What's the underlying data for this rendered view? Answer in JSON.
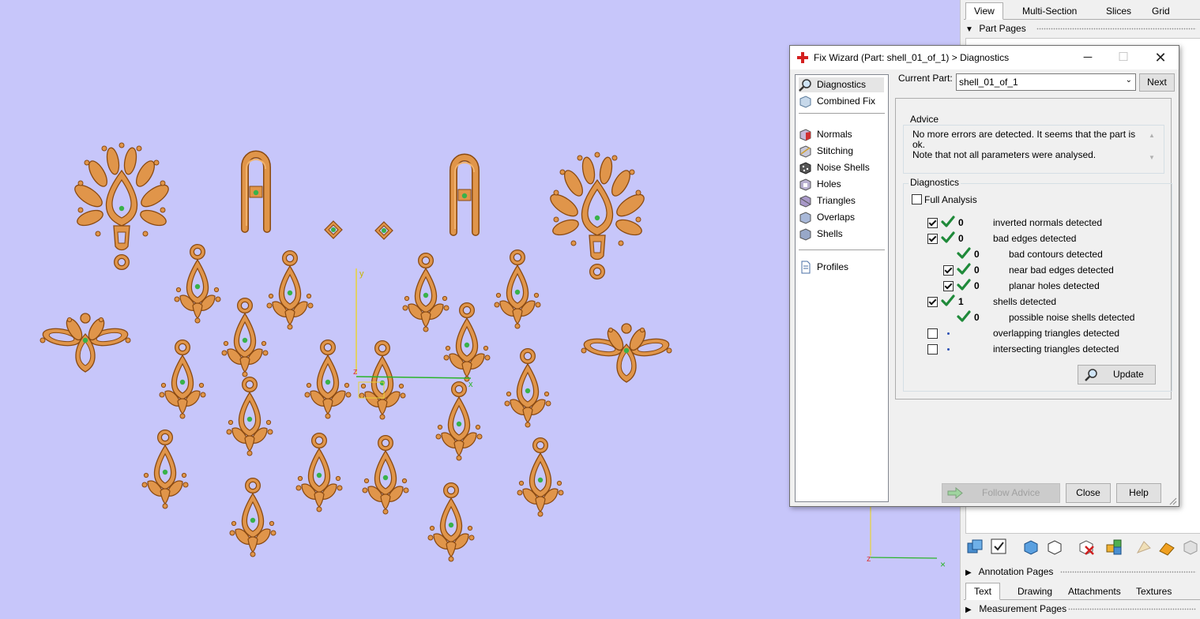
{
  "right_panel": {
    "top_tabs": [
      "View",
      "Multi-Section",
      "Slices",
      "Grid"
    ],
    "part_pages_label": "Part Pages",
    "annotation_pages_label": "Annotation Pages",
    "bottom_tabs": [
      "Text",
      "Drawing",
      "Attachments",
      "Textures"
    ],
    "measurement_pages_label": "Measurement Pages"
  },
  "dialog": {
    "title": "Fix Wizard (Part: shell_01_of_1) > Diagnostics",
    "nav_items": [
      {
        "label": "Diagnostics",
        "icon": "magnifier-icon"
      },
      {
        "label": "Combined Fix",
        "icon": "cube-icon"
      },
      {
        "label": "Normals",
        "icon": "normals-cube-icon"
      },
      {
        "label": "Stitching",
        "icon": "stitching-cube-icon"
      },
      {
        "label": "Noise Shells",
        "icon": "noise-shells-icon"
      },
      {
        "label": "Holes",
        "icon": "holes-cube-icon"
      },
      {
        "label": "Triangles",
        "icon": "triangles-cube-icon"
      },
      {
        "label": "Overlaps",
        "icon": "overlaps-cube-icon"
      },
      {
        "label": "Shells",
        "icon": "shells-cube-icon"
      },
      {
        "label": "Profiles",
        "icon": "profiles-document-icon"
      }
    ],
    "current_part_label": "Current Part:",
    "current_part_value": "shell_01_of_1",
    "next_label": "Next",
    "advice_label": "Advice",
    "advice_text": "No more errors are detected. It seems that the part is ok.\nNote that not all parameters were analysed.",
    "diagnostics_label": "Diagnostics",
    "full_analysis_label": "Full Analysis",
    "rows": [
      {
        "checkbox": true,
        "checked": true,
        "status": "ok",
        "count": "0",
        "label": "inverted normals detected",
        "indent": 0
      },
      {
        "checkbox": true,
        "checked": true,
        "status": "ok",
        "count": "0",
        "label": "bad edges detected",
        "indent": 0
      },
      {
        "checkbox": false,
        "checked": false,
        "status": "ok",
        "count": "0",
        "label": "bad contours detected",
        "indent": 1
      },
      {
        "checkbox": true,
        "checked": true,
        "status": "ok",
        "count": "0",
        "label": "near bad edges detected",
        "indent": 1
      },
      {
        "checkbox": true,
        "checked": true,
        "status": "ok",
        "count": "0",
        "label": "planar holes detected",
        "indent": 1
      },
      {
        "checkbox": true,
        "checked": true,
        "status": "ok",
        "count": "1",
        "label": "shells detected",
        "indent": 0
      },
      {
        "checkbox": false,
        "checked": false,
        "status": "ok",
        "count": "0",
        "label": "possible noise shells detected",
        "indent": 1
      },
      {
        "checkbox": true,
        "checked": false,
        "status": "none",
        "count": "",
        "label": "overlapping triangles detected",
        "indent": 0
      },
      {
        "checkbox": true,
        "checked": false,
        "status": "none",
        "count": "",
        "label": "intersecting triangles detected",
        "indent": 0
      }
    ],
    "update_label": "Update",
    "follow_advice_label": "Follow Advice",
    "close_label": "Close",
    "help_label": "Help"
  },
  "viewport": {
    "axis_y_label": "Y",
    "axis_z_label": "Z",
    "axis_x_label": "X"
  },
  "colors": {
    "viewport_bg": "#c7c6fa",
    "part_fill": "#d98c3b",
    "part_stroke": "#8a4a12",
    "marker": "#38b24a",
    "check_green": "#1f8a3a"
  }
}
